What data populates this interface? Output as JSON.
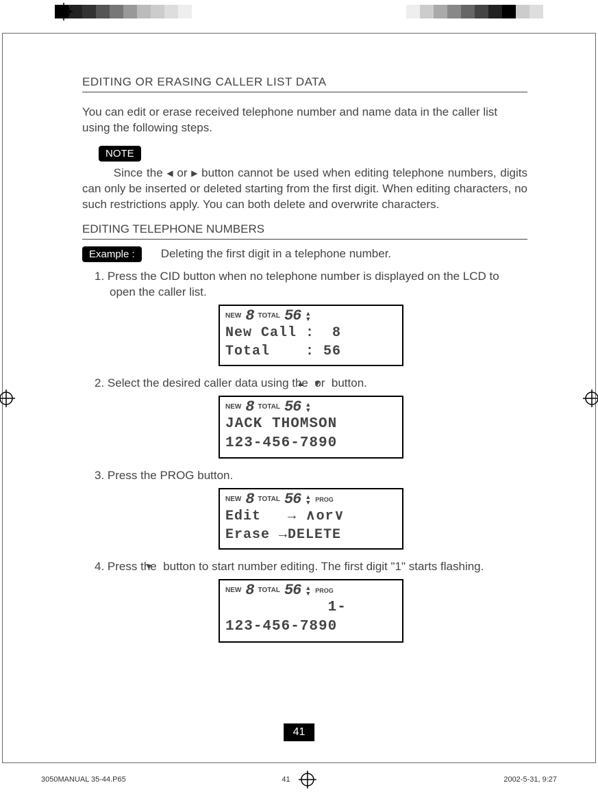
{
  "header": {
    "title": "EDITING OR ERASING CALLER LIST DATA",
    "intro": "You can edit or erase received telephone number and name data in the caller list using the following steps."
  },
  "note": {
    "label": "NOTE",
    "body_a": "Since the ",
    "body_b": " or ",
    "body_c": " button cannot be used when editing telephone numbers, digits can only be inserted or deleted starting from the first digit. When       editing characters, no such restrictions apply. You can both delete and overwrite characters."
  },
  "subsection": {
    "title": "EDITING TELEPHONE NUMBERS"
  },
  "example": {
    "label": "Example :",
    "text": "Deleting the first digit in a telephone number."
  },
  "steps": [
    {
      "num": "1.",
      "text": "Press the CID button when no telephone number is displayed on the LCD to open the caller list.",
      "lcd": {
        "new": "NEW",
        "new_digit": "8",
        "total": "TOTAL",
        "total_digit": "56",
        "prog": "",
        "line1": "New Call :  8",
        "line2": "Total    : 56"
      }
    },
    {
      "num": "2.",
      "text_a": "Select the desired caller data using the ",
      "text_b": " or ",
      "text_c": " button.",
      "lcd": {
        "new": "NEW",
        "new_digit": "8",
        "total": "TOTAL",
        "total_digit": "56",
        "prog": "",
        "line1": "JACK THOMSON",
        "line2": "123-456-7890"
      }
    },
    {
      "num": "3.",
      "text": "Press the PROG button.",
      "lcd": {
        "new": "NEW",
        "new_digit": "8",
        "total": "TOTAL",
        "total_digit": "56",
        "prog": "PROG",
        "line1": "Edit   → ∧or∨",
        "line2": "Erase →DELETE"
      }
    },
    {
      "num": "4.",
      "text_a": "Press the ",
      "text_b": " button to start number editing. The first digit \"1\" starts flashing.",
      "lcd": {
        "new": "NEW",
        "new_digit": "8",
        "total": "TOTAL",
        "total_digit": "56",
        "prog": "PROG",
        "line1": "           1-",
        "line2": "123-456-7890"
      }
    }
  ],
  "page_number": "41",
  "footer": {
    "file": "3050MANUAL 35-44.P65",
    "page": "41",
    "date": "2002-5-31, 9:27"
  },
  "symbols": {
    "left": "◀",
    "right": "▶",
    "up": "▲",
    "down": "▼"
  }
}
